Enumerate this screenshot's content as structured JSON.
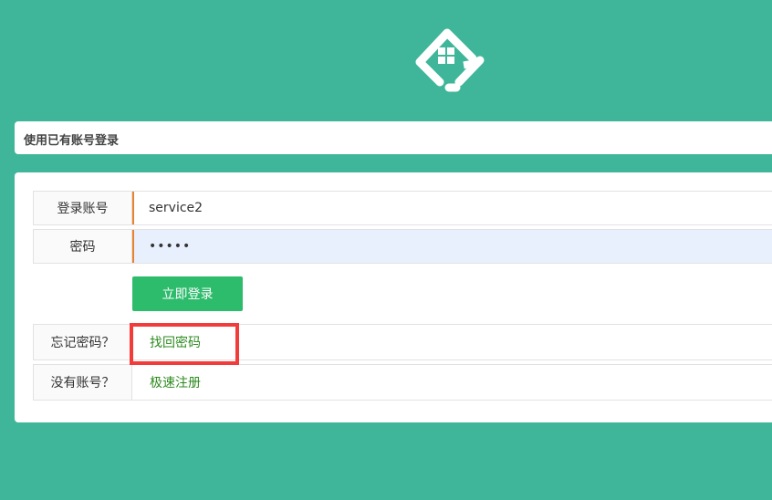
{
  "logo": {
    "icon": "house-diamond-logo-icon"
  },
  "header": {
    "title": "使用已有账号登录"
  },
  "form": {
    "account_label": "登录账号",
    "account_value": "service2",
    "password_label": "密码",
    "password_value": "•••••",
    "login_button": "立即登录",
    "forgot_label": "忘记密码？",
    "forgot_link": "找回密码",
    "register_label": "没有账号？",
    "register_link": "极速注册"
  },
  "colors": {
    "background": "#3fb699",
    "accent_border": "#e8822f",
    "button": "#2dbb6c",
    "link": "#2e8b1f",
    "highlight": "#f23b3b"
  }
}
